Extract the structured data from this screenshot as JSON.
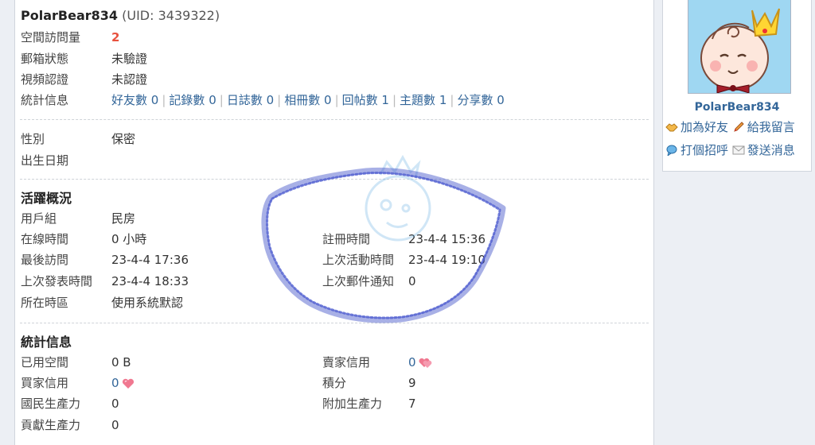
{
  "profile": {
    "username": "PolarBear834",
    "uid_text": "(UID: 3439322)",
    "basic": [
      {
        "label": "空間訪問量",
        "value": "2"
      },
      {
        "label": "郵箱狀態",
        "value": "未驗證"
      },
      {
        "label": "視頻認證",
        "value": "未認證"
      }
    ],
    "stats_label": "統計信息",
    "stats": [
      {
        "label": "好友數",
        "count": "0"
      },
      {
        "label": "記錄數",
        "count": "0"
      },
      {
        "label": "日誌數",
        "count": "0"
      },
      {
        "label": "相冊數",
        "count": "0"
      },
      {
        "label": "回帖數",
        "count": "1"
      },
      {
        "label": "主題數",
        "count": "1"
      },
      {
        "label": "分享數",
        "count": "0"
      }
    ],
    "gender_label": "性別",
    "gender_value": "保密",
    "birthday_label": "出生日期"
  },
  "activity": {
    "title": "活躍概況",
    "group_label": "用戶組",
    "group_value": "民房",
    "online_label": "在線時間",
    "online_value": "0 小時",
    "last_visit_label": "最後訪問",
    "last_visit_value": "23-4-4 17:36",
    "last_post_label": "上次發表時間",
    "last_post_value": "23-4-4 18:33",
    "timezone_label": "所在時區",
    "timezone_value": "使用系統默認",
    "reg_label": "註冊時間",
    "reg_value": "23-4-4 15:36",
    "last_active_label": "上次活動時間",
    "last_active_value": "23-4-4 19:10",
    "last_mail_label": "上次郵件通知",
    "last_mail_value": "0"
  },
  "statistics": {
    "title": "統計信息",
    "used_space_label": "已用空間",
    "used_space_value": "0 B",
    "buyer_credit_label": "買家信用",
    "buyer_credit_value": "0",
    "citizen_label": "國民生產力",
    "citizen_value": "0",
    "contrib_label": "貢獻生產力",
    "contrib_value": "0",
    "seller_credit_label": "賣家信用",
    "seller_credit_value": "0",
    "points_label": "積分",
    "points_value": "9",
    "extra_label": "附加生產力",
    "extra_value": "7"
  },
  "sidebar": {
    "name": "PolarBear834",
    "add_friend": "加為好友",
    "leave_message": "給我留言",
    "greet": "打個招呼",
    "send_message": "發送消息"
  },
  "colors": {
    "link": "#336699",
    "visit_count": "#e8523f",
    "heart": "#f07890",
    "annotation_circle": "#3f4fc8"
  },
  "icons": {
    "heart": "heart-icon",
    "add_friend": "handshake-icon",
    "leave_message": "pencil-icon",
    "greet": "speech-bubble-icon",
    "send_message": "envelope-icon"
  }
}
